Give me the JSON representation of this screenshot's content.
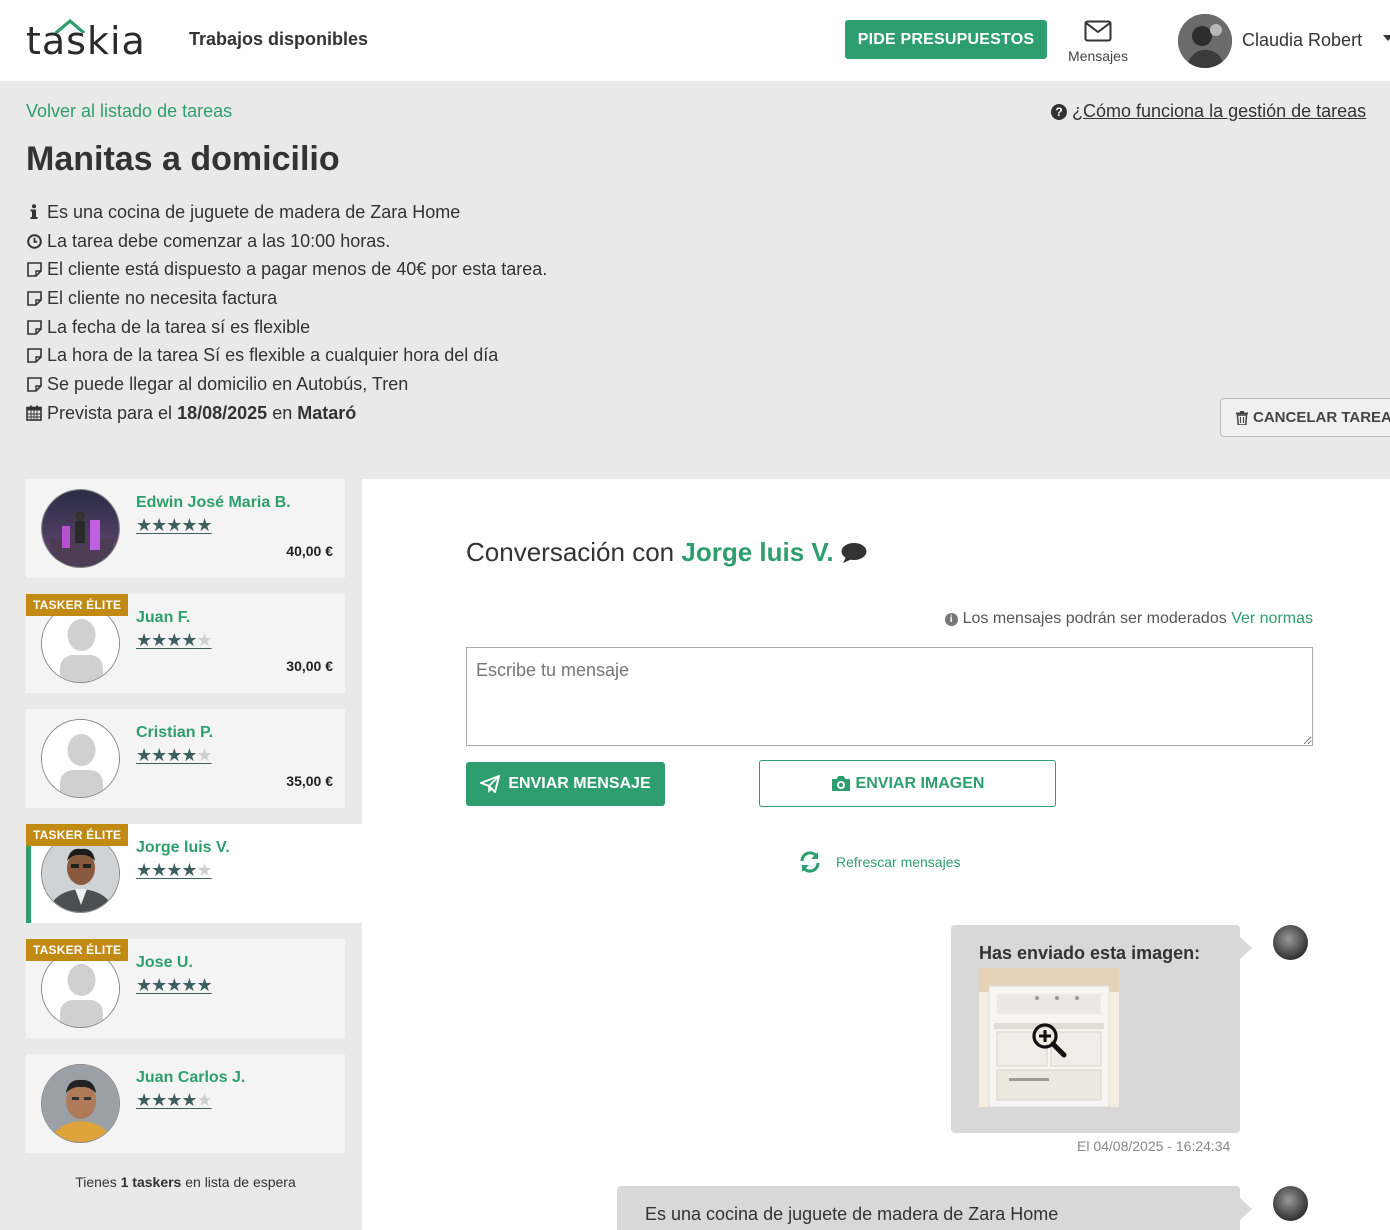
{
  "header": {
    "logo_text": "taskia",
    "nav_jobs": "Trabajos disponibles",
    "budget_button": "PIDE PRESUPUESTOS",
    "messages_label": "Mensajes",
    "user_name": "Claudia Robert"
  },
  "task": {
    "back_link": "Volver al listado de tareas",
    "help_link": "¿Cómo funciona la gestión de tareas",
    "title": "Manitas a domicilio",
    "details": [
      "Es una cocina de juguete de madera de Zara Home",
      "La tarea debe comenzar a las 10:00 horas.",
      "El cliente está dispuesto a pagar menos de 40€ por esta tarea.",
      "El cliente no necesita factura",
      "La fecha de la tarea sí es flexible",
      "La hora de la tarea Sí es flexible a cualquier hora del día",
      "Se puede llegar al domicilio en Autobús, Tren"
    ],
    "schedule": {
      "prefix": "Prevista para el",
      "date": "18/08/2025",
      "middle": "en",
      "city": "Mataró"
    },
    "cancel_button": "CANCELAR TAREA"
  },
  "taskers": [
    {
      "name": "Edwin José Maria B.",
      "rating": 5,
      "price": "40,00 €",
      "elite": false,
      "avatar": "photo"
    },
    {
      "name": "Juan F.",
      "rating": 4.5,
      "price": "30,00 €",
      "elite": true,
      "avatar": "placeholder"
    },
    {
      "name": "Cristian P.",
      "rating": 4.5,
      "price": "35,00 €",
      "elite": false,
      "avatar": "placeholder"
    },
    {
      "name": "Jorge luis V.",
      "rating": 4.5,
      "price": "",
      "elite": true,
      "avatar": "photo",
      "active": true
    },
    {
      "name": "Jose U.",
      "rating": 5,
      "price": "",
      "elite": true,
      "avatar": "placeholder"
    },
    {
      "name": "Juan Carlos J.",
      "rating": 4,
      "price": "",
      "elite": false,
      "avatar": "photo"
    }
  ],
  "elite_badge": "TASKER ÉLITE",
  "waitlist": {
    "prefix": "Tienes",
    "count": "1 taskers",
    "suffix": "en lista de espera"
  },
  "conversation": {
    "title_prefix": "Conversación con",
    "with": "Jorge luis V.",
    "moderation_text": "Los mensajes podrán ser moderados",
    "moderation_link": "Ver normas",
    "input_placeholder": "Escribe tu mensaje",
    "send_button": "ENVIAR MENSAJE",
    "image_button": "ENVIAR IMAGEN",
    "refresh_label": "Refrescar mensajes",
    "messages": [
      {
        "type": "image",
        "text": "Has enviado esta imagen:",
        "timestamp": "El 04/08/2025 - 16:24:34"
      },
      {
        "type": "text",
        "text": "Es una cocina de juguete de madera de Zara Home"
      }
    ]
  },
  "colors": {
    "accent": "#2f9e6f",
    "elite": "#c08a13",
    "bubble": "#d8d8d8"
  }
}
